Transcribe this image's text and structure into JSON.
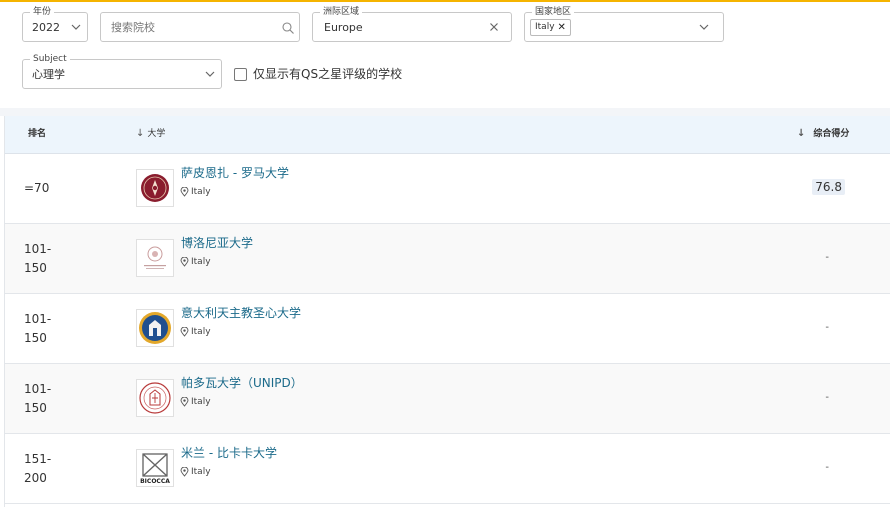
{
  "filters": {
    "year": {
      "label": "年份",
      "value": "2022"
    },
    "search": {
      "placeholder": "搜索院校"
    },
    "region": {
      "label": "洲际区域",
      "value": "Europe"
    },
    "country": {
      "label": "国家地区",
      "chip": "Italy"
    },
    "subject": {
      "label": "Subject",
      "value": "心理学"
    },
    "qs_stars_only": {
      "label": "仅显示有QS之星评级的学校",
      "checked": false
    }
  },
  "table": {
    "headers": {
      "rank": "排名",
      "university": "大学",
      "score": "综合得分"
    },
    "rows": [
      {
        "rank": "=70",
        "name": "萨皮恩扎 - 罗马大学",
        "country": "Italy",
        "score": "76.8",
        "logo": "sapienza-logo"
      },
      {
        "rank": "101-\n150",
        "name": "博洛尼亚大学",
        "country": "Italy",
        "score": "-",
        "logo": "bologna-logo"
      },
      {
        "rank": "101-\n150",
        "name": "意大利天主教圣心大学",
        "country": "Italy",
        "score": "-",
        "logo": "cattolica-logo"
      },
      {
        "rank": "101-\n150",
        "name": "帕多瓦大学（UNIPD）",
        "country": "Italy",
        "score": "-",
        "logo": "padova-logo"
      },
      {
        "rank": "151-\n200",
        "name": "米兰 - 比卡卡大学",
        "country": "Italy",
        "score": "-",
        "logo": "bicocca-logo",
        "logo_text": "BICOCCA"
      }
    ]
  },
  "colors": {
    "accent": "#f5b400",
    "link": "#1b6a8a",
    "header_bg": "#edf5fc"
  }
}
